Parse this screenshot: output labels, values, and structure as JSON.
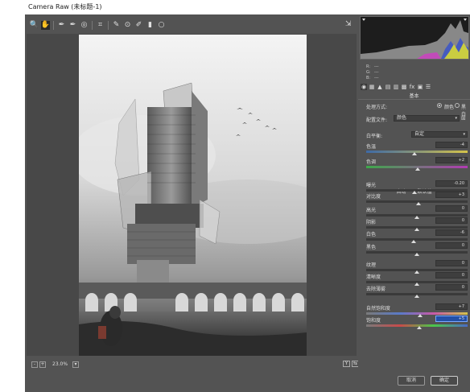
{
  "window": {
    "title": "Camera Raw (未标题-1)"
  },
  "toolbar": {
    "tools": [
      {
        "name": "zoom-tool",
        "glyph": "🔍"
      },
      {
        "name": "hand-tool",
        "glyph": "✋"
      },
      {
        "name": "white-balance-tool",
        "glyph": "✒"
      },
      {
        "name": "color-sampler-tool",
        "glyph": "✒"
      },
      {
        "name": "targeted-adjustment-tool",
        "glyph": "◎"
      },
      {
        "name": "crop-tool",
        "glyph": "⌗"
      },
      {
        "name": "spot-removal-tool",
        "glyph": "✎"
      },
      {
        "name": "red-eye-tool",
        "glyph": "⊙"
      },
      {
        "name": "adjustment-brush-tool",
        "glyph": "✐"
      },
      {
        "name": "graduated-filter-tool",
        "glyph": "▮"
      },
      {
        "name": "radial-filter-tool",
        "glyph": "○"
      }
    ],
    "fullscreen_glyph": "⇲"
  },
  "bottombar": {
    "zoom_minus": "-",
    "zoom_plus": "+",
    "zoom_value": "23.0%",
    "dropdown_glyph": "▾",
    "view_buttons": [
      "Y",
      "⇆",
      "⇿",
      "≡"
    ]
  },
  "readout": {
    "r_label": "R:",
    "g_label": "G:",
    "b_label": "B:",
    "r": "---",
    "g": "---",
    "b": "---"
  },
  "panel_tabs": [
    "◉",
    "▦",
    "▲",
    "▤",
    "▥",
    "▩",
    "fx",
    "▣",
    "☰"
  ],
  "basic": {
    "title": "基本",
    "treatment_label": "处理方式:",
    "treatment_color": "颜色",
    "treatment_bw": "黑白",
    "profile_label": "配置文件:",
    "profile_value": "颜色",
    "profile_grid_glyph": "⊞",
    "wb_label": "白平衡:",
    "wb_value": "自定",
    "temp_label": "色温",
    "temp_value": "-4",
    "tint_label": "色调",
    "tint_value": "+2",
    "auto_label": "自动",
    "default_label": "默认值",
    "exposure_label": "曝光",
    "exposure_value": "-0.20",
    "contrast_label": "对比度",
    "contrast_value": "+3",
    "highlights_label": "高光",
    "highlights_value": "0",
    "shadows_label": "阴影",
    "shadows_value": "0",
    "whites_label": "白色",
    "whites_value": "-6",
    "blacks_label": "黑色",
    "blacks_value": "0",
    "texture_label": "纹理",
    "texture_value": "0",
    "clarity_label": "清晰度",
    "clarity_value": "0",
    "dehaze_label": "去除薄雾",
    "dehaze_value": "0",
    "vibrance_label": "自然饱和度",
    "vibrance_value": "+7",
    "saturation_label": "饱和度",
    "saturation_value": "+5"
  },
  "slider_levels": {
    "temp": -4,
    "tint": 2,
    "exposure": -0.2,
    "contrast": 3,
    "highlights": 0,
    "shadows": 0,
    "whites": -6,
    "blacks": 0,
    "texture": 0,
    "clarity": 0,
    "dehaze": 0,
    "vibrance": 7,
    "saturation": 5
  },
  "footer": {
    "cancel": "取消",
    "ok": "确定"
  },
  "colors": {
    "panel_bg": "#535353",
    "canvas_bg": "#484848",
    "focus_field": "#2350a8"
  }
}
